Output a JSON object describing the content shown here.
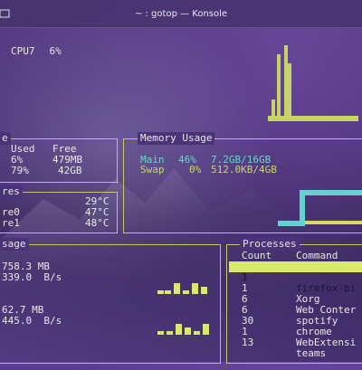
{
  "window": {
    "title": "~ : gotop — Konsole"
  },
  "cpu": {
    "label": "CPU7",
    "value": "6%"
  },
  "disk": {
    "title": "e",
    "headers": [
      "Used",
      "Free"
    ],
    "rows": [
      {
        "used": "6%",
        "free": "479MB"
      },
      {
        "used": "79%",
        "free": "42GB"
      }
    ]
  },
  "temps": {
    "title": "res",
    "rows": [
      {
        "name": "",
        "value": "29°C"
      },
      {
        "name": "re0",
        "value": "47°C"
      },
      {
        "name": "re1",
        "value": "48°C"
      }
    ]
  },
  "memory": {
    "title": "Memory Usage",
    "main": {
      "label": "Main",
      "percent": "46%",
      "amount": "7.2GB/16GB"
    },
    "swap": {
      "label": "Swap",
      "percent": "0%",
      "amount": "512.0KB/4GB"
    }
  },
  "net": {
    "title": "sage",
    "rx_total": "758.3 MB",
    "rx_rate": "339.0  B/s",
    "tx_total": "62.7 MB",
    "tx_rate": "445.0  B/s"
  },
  "processes": {
    "title": "Processes",
    "headers": [
      "Count",
      "Command"
    ],
    "rows": [
      {
        "count": "1",
        "command": "firefox-bi",
        "selected": true
      },
      {
        "count": "1",
        "command": "Xorg"
      },
      {
        "count": "6",
        "command": "Web Conter"
      },
      {
        "count": "6",
        "command": "spotify"
      },
      {
        "count": "30",
        "command": "chrome"
      },
      {
        "count": "1",
        "command": "WebExtensi"
      },
      {
        "count": "13",
        "command": "teams"
      }
    ]
  },
  "colors": {
    "accent_yellow": "#d9e86f",
    "memory_cyan": "#61d9cc",
    "border": "#c9c56a"
  }
}
